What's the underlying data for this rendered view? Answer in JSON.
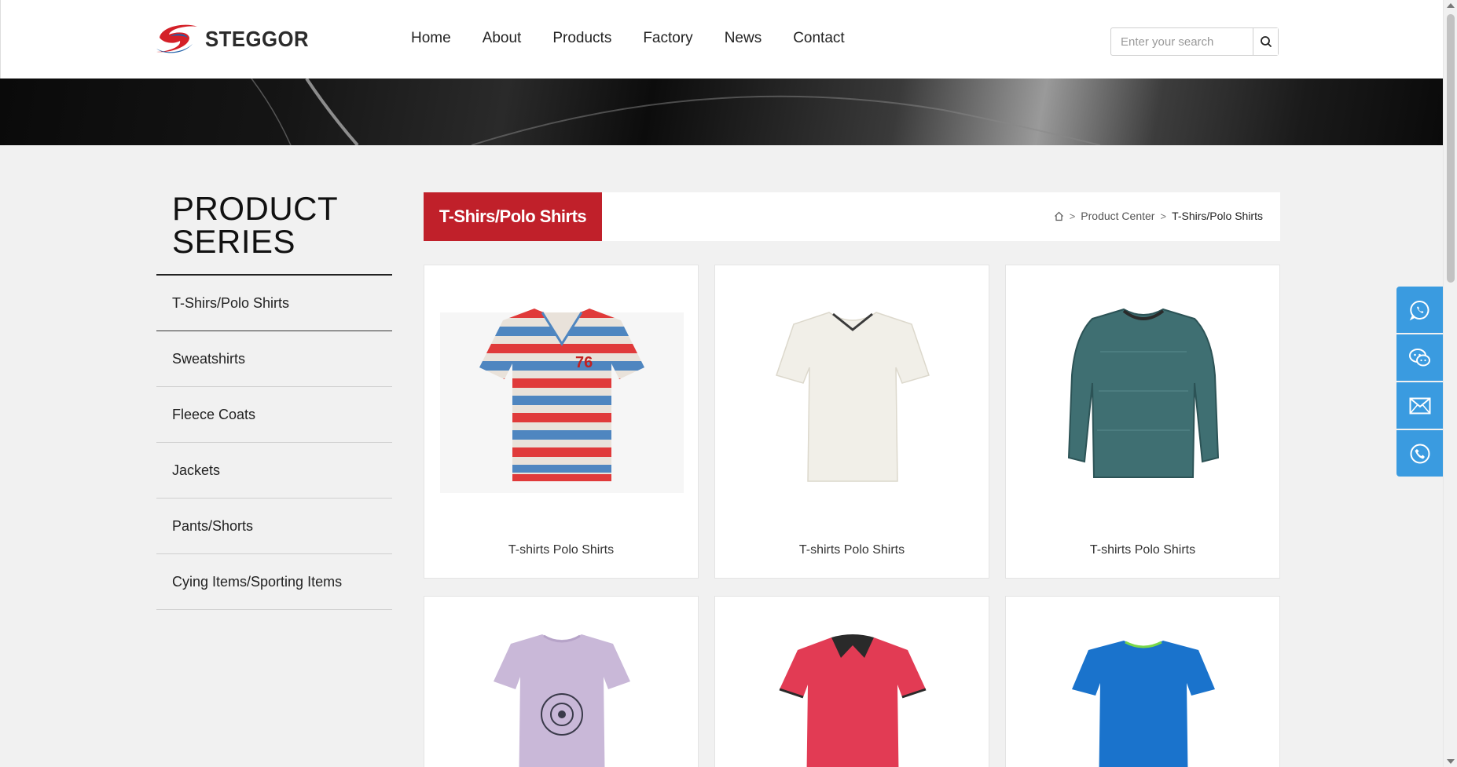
{
  "header": {
    "brand": "STEGGOR",
    "nav": [
      "Home",
      "About",
      "Products",
      "Factory",
      "News",
      "Contact"
    ],
    "search_placeholder": "Enter your search"
  },
  "sidebar": {
    "title_line1": "PRODUCT",
    "title_line2": "SERIES",
    "items": [
      "T-Shirs/Polo Shirts",
      "Sweatshirts",
      "Fleece Coats",
      "Jackets",
      "Pants/Shorts",
      "Cying Items/Sporting Items"
    ]
  },
  "category": {
    "title": "T-Shirs/Polo Shirts",
    "breadcrumb": [
      "Product Center",
      "T-Shirs/Polo Shirts"
    ]
  },
  "products": [
    {
      "caption": "T-shirts Polo Shirts",
      "icon": "striped-tshirt-image"
    },
    {
      "caption": "T-shirts Polo Shirts",
      "icon": "white-tshirt-image"
    },
    {
      "caption": "T-shirts Polo Shirts",
      "icon": "teal-longsleeve-image"
    },
    {
      "caption": "",
      "icon": "lavender-tshirt-image"
    },
    {
      "caption": "",
      "icon": "red-polo-image"
    },
    {
      "caption": "",
      "icon": "blue-tshirt-image"
    }
  ],
  "floating_contacts": [
    "whatsapp-icon",
    "wechat-icon",
    "email-icon",
    "phone-icon"
  ],
  "colors": {
    "accent_red": "#c0202a",
    "float_blue": "#3a9be0"
  }
}
